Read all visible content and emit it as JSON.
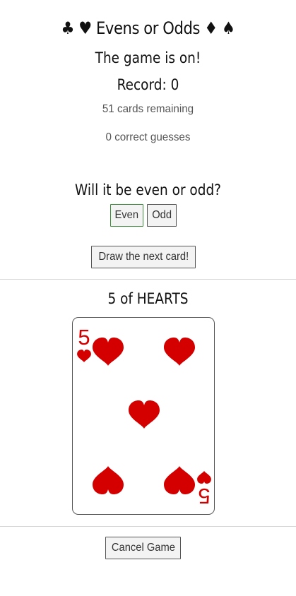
{
  "header": {
    "title": "♣ ♥ Evens or Odds ♦ ♠",
    "status": "The game is on!",
    "record": "Record: 0",
    "cards_remaining": "51 cards remaining",
    "correct_guesses": "0 correct guesses"
  },
  "guess": {
    "question": "Will it be even or odd?",
    "even_label": "Even",
    "odd_label": "Odd",
    "selected": "Even"
  },
  "draw": {
    "label": "Draw the next card!"
  },
  "card": {
    "name": "5 of HEARTS",
    "rank": "5",
    "suit_symbol": "♥",
    "suit_icon": "heart-icon",
    "color": "#d40000"
  },
  "footer": {
    "cancel_label": "Cancel Game"
  }
}
